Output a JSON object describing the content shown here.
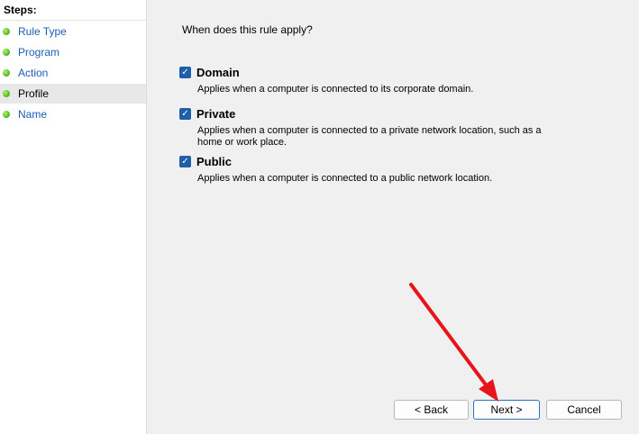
{
  "sidebar": {
    "header": "Steps:",
    "items": [
      {
        "label": "Rule Type"
      },
      {
        "label": "Program"
      },
      {
        "label": "Action"
      },
      {
        "label": "Profile"
      },
      {
        "label": "Name"
      }
    ]
  },
  "main": {
    "question": "When does this rule apply?",
    "options": [
      {
        "label": "Domain",
        "checked": true,
        "description": "Applies when a computer is connected to its corporate domain."
      },
      {
        "label": "Private",
        "checked": true,
        "description": "Applies when a computer is connected to a private network location, such as a home or work place."
      },
      {
        "label": "Public",
        "checked": true,
        "description": "Applies when a computer is connected to a public network location."
      }
    ]
  },
  "buttons": {
    "back": "< Back",
    "next": "Next >",
    "cancel": "Cancel"
  },
  "colors": {
    "link": "#1a5fb4",
    "checkbox": "#1f5fa8",
    "annotation_arrow": "#e8141b"
  },
  "annotation": {
    "type": "arrow",
    "points_to": "next-button"
  }
}
